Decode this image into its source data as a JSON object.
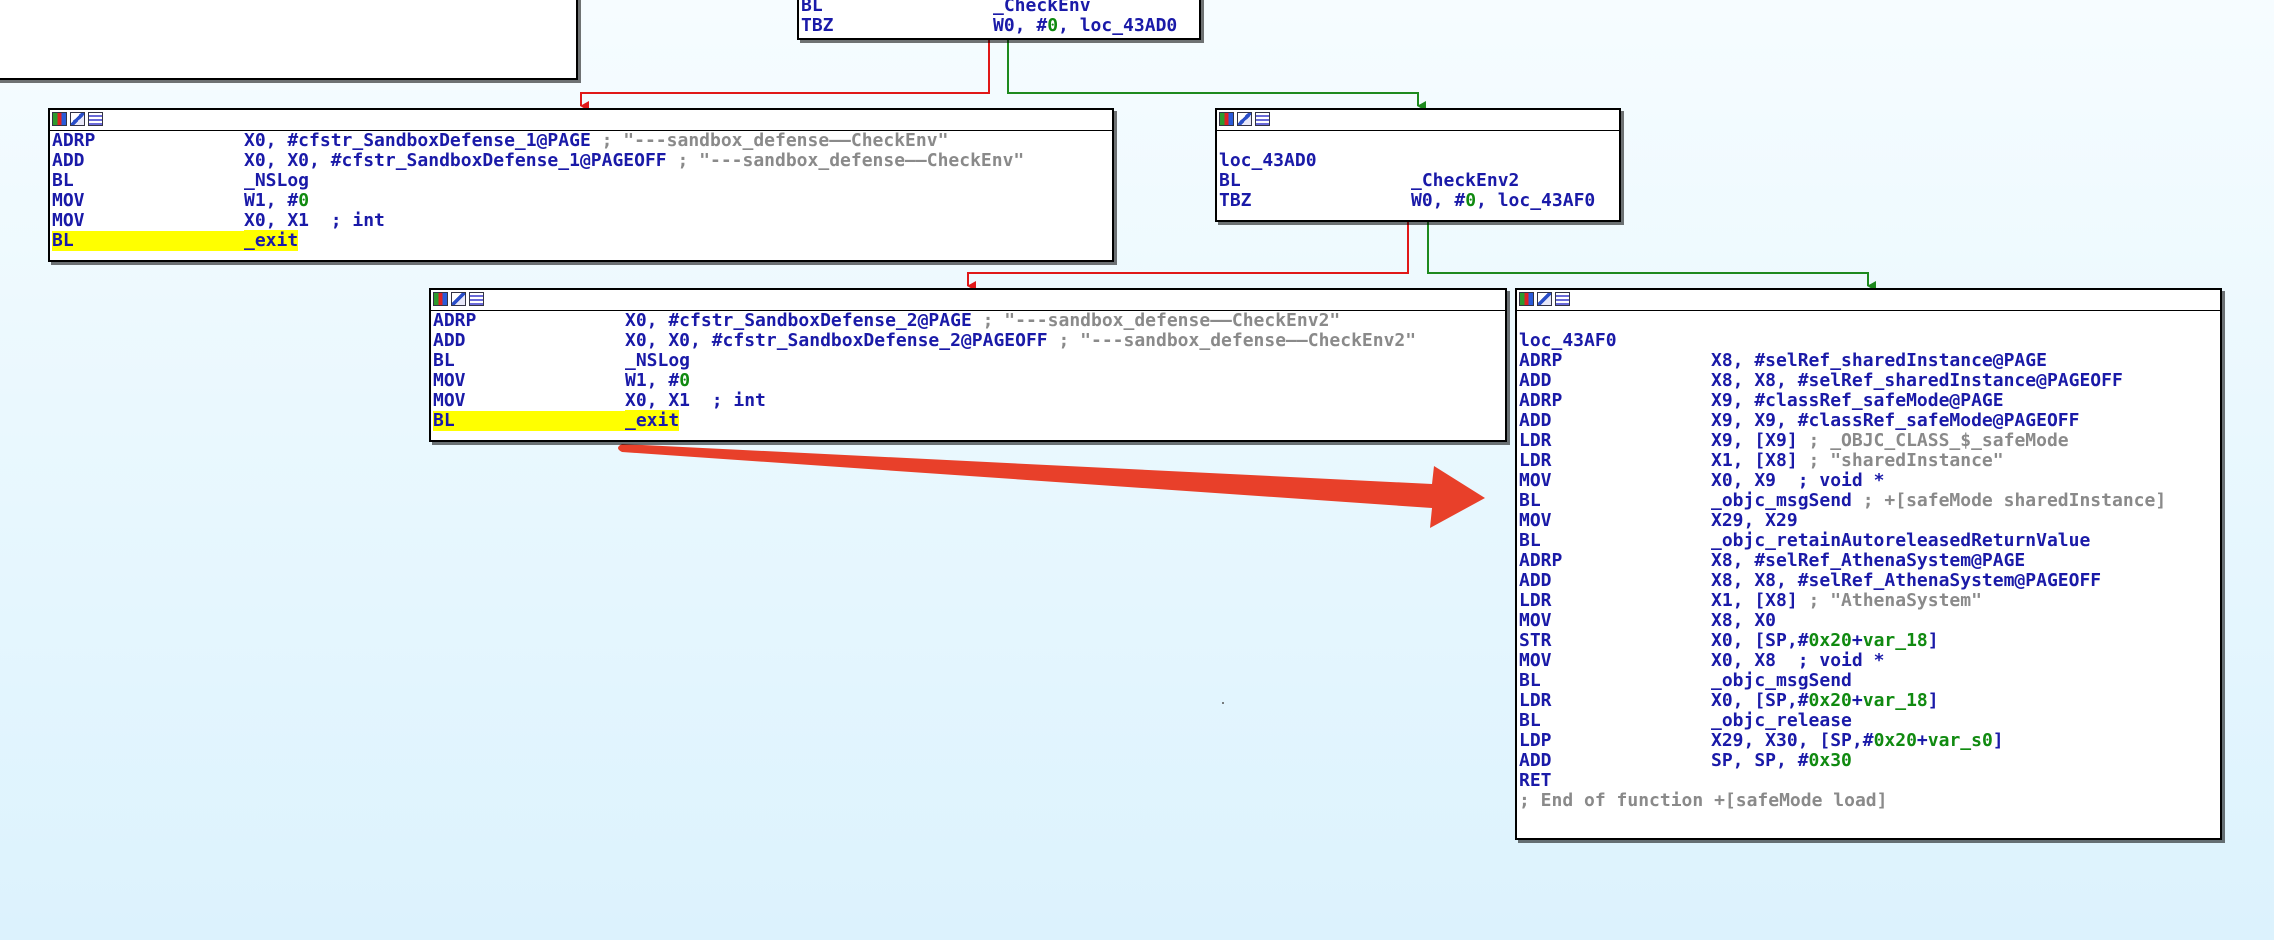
{
  "app": {
    "name": "IDA Pro graph view"
  },
  "top_partial_node": {
    "lines": [
      {
        "mnemonic": "BL",
        "operands": "_CheckEnv"
      },
      {
        "mnemonic": "TBZ",
        "operands": "W0, #0, loc_43AD0"
      }
    ]
  },
  "node_checkenv_fail": {
    "lines": [
      {
        "mnemonic": "ADRP",
        "operands": "X0, #cfstr_SandboxDefense_1@PAGE",
        "comment": " ; \"---sandbox_defense——CheckEnv\""
      },
      {
        "mnemonic": "ADD",
        "operands": "X0, X0, #cfstr_SandboxDefense_1@PAGEOFF",
        "comment": " ; \"---sandbox_defense——CheckEnv\""
      },
      {
        "mnemonic": "BL",
        "operands": "_NSLog"
      },
      {
        "mnemonic": "MOV",
        "operands": "W1, #0"
      },
      {
        "mnemonic": "MOV",
        "operands": "X0, X1",
        "comment": "  ; int"
      },
      {
        "mnemonic": "BL",
        "operands": "_exit",
        "highlight": true
      }
    ]
  },
  "node_loc_43AD0": {
    "label": "loc_43AD0",
    "lines": [
      {
        "mnemonic": "BL",
        "operands": "_CheckEnv2"
      },
      {
        "mnemonic": "TBZ",
        "operands": "W0, #0, loc_43AF0"
      }
    ]
  },
  "node_checkenv2_fail": {
    "lines": [
      {
        "mnemonic": "ADRP",
        "operands": "X0, #cfstr_SandboxDefense_2@PAGE",
        "comment": " ; \"---sandbox_defense——CheckEnv2\""
      },
      {
        "mnemonic": "ADD",
        "operands": "X0, X0, #cfstr_SandboxDefense_2@PAGEOFF",
        "comment": " ; \"---sandbox_defense——CheckEnv2\""
      },
      {
        "mnemonic": "BL",
        "operands": "_NSLog"
      },
      {
        "mnemonic": "MOV",
        "operands": "W1, #0"
      },
      {
        "mnemonic": "MOV",
        "operands": "X0, X1",
        "comment": "  ; int"
      },
      {
        "mnemonic": "BL",
        "operands": "_exit",
        "highlight": true
      }
    ]
  },
  "node_loc_43AF0": {
    "label": "loc_43AF0",
    "lines": [
      {
        "mnemonic": "ADRP",
        "operands": "X8, #selRef_sharedInstance@PAGE"
      },
      {
        "mnemonic": "ADD",
        "operands": "X8, X8, #selRef_sharedInstance@PAGEOFF"
      },
      {
        "mnemonic": "ADRP",
        "operands": "X9, #classRef_safeMode@PAGE"
      },
      {
        "mnemonic": "ADD",
        "operands": "X9, X9, #classRef_safeMode@PAGEOFF"
      },
      {
        "mnemonic": "LDR",
        "operands": "X9, [X9]",
        "comment": " ; _OBJC_CLASS_$_safeMode"
      },
      {
        "mnemonic": "LDR",
        "operands": "X1, [X8]",
        "comment": " ; \"sharedInstance\""
      },
      {
        "mnemonic": "MOV",
        "operands": "X0, X9",
        "comment": "  ; void *"
      },
      {
        "mnemonic": "BL",
        "operands": "_objc_msgSend",
        "comment": " ; +[safeMode sharedInstance]"
      },
      {
        "mnemonic": "MOV",
        "operands": "X29, X29"
      },
      {
        "mnemonic": "BL",
        "operands": "_objc_retainAutoreleasedReturnValue"
      },
      {
        "mnemonic": "ADRP",
        "operands": "X8, #selRef_AthenaSystem@PAGE"
      },
      {
        "mnemonic": "ADD",
        "operands": "X8, X8, #selRef_AthenaSystem@PAGEOFF"
      },
      {
        "mnemonic": "LDR",
        "operands": "X1, [X8]",
        "comment": " ; \"AthenaSystem\""
      },
      {
        "mnemonic": "MOV",
        "operands": "X8, X0"
      },
      {
        "mnemonic": "STR",
        "operands": "X0, [SP,#0x20+var_18]"
      },
      {
        "mnemonic": "MOV",
        "operands": "X0, X8",
        "comment": "  ; void *"
      },
      {
        "mnemonic": "BL",
        "operands": "_objc_msgSend"
      },
      {
        "mnemonic": "LDR",
        "operands": "X0, [SP,#0x20+var_18]"
      },
      {
        "mnemonic": "BL",
        "operands": "_objc_release"
      },
      {
        "mnemonic": "LDP",
        "operands": "X29, X30, [SP,#0x20+var_s0]"
      },
      {
        "mnemonic": "ADD",
        "operands": "SP, SP, #0x30"
      },
      {
        "mnemonic": "RET",
        "operands": ""
      }
    ],
    "footer": "; End of function +[safeMode load]"
  },
  "colors": {
    "branch_true": "#1e8a1e",
    "branch_false": "#e01818",
    "annotation_arrow": "#e8402a",
    "highlight": "#ffff00",
    "code_blue": "#1a1aa8"
  },
  "icons": [
    "graph-overview-icon",
    "edit-node-icon",
    "xrefs-icon"
  ]
}
